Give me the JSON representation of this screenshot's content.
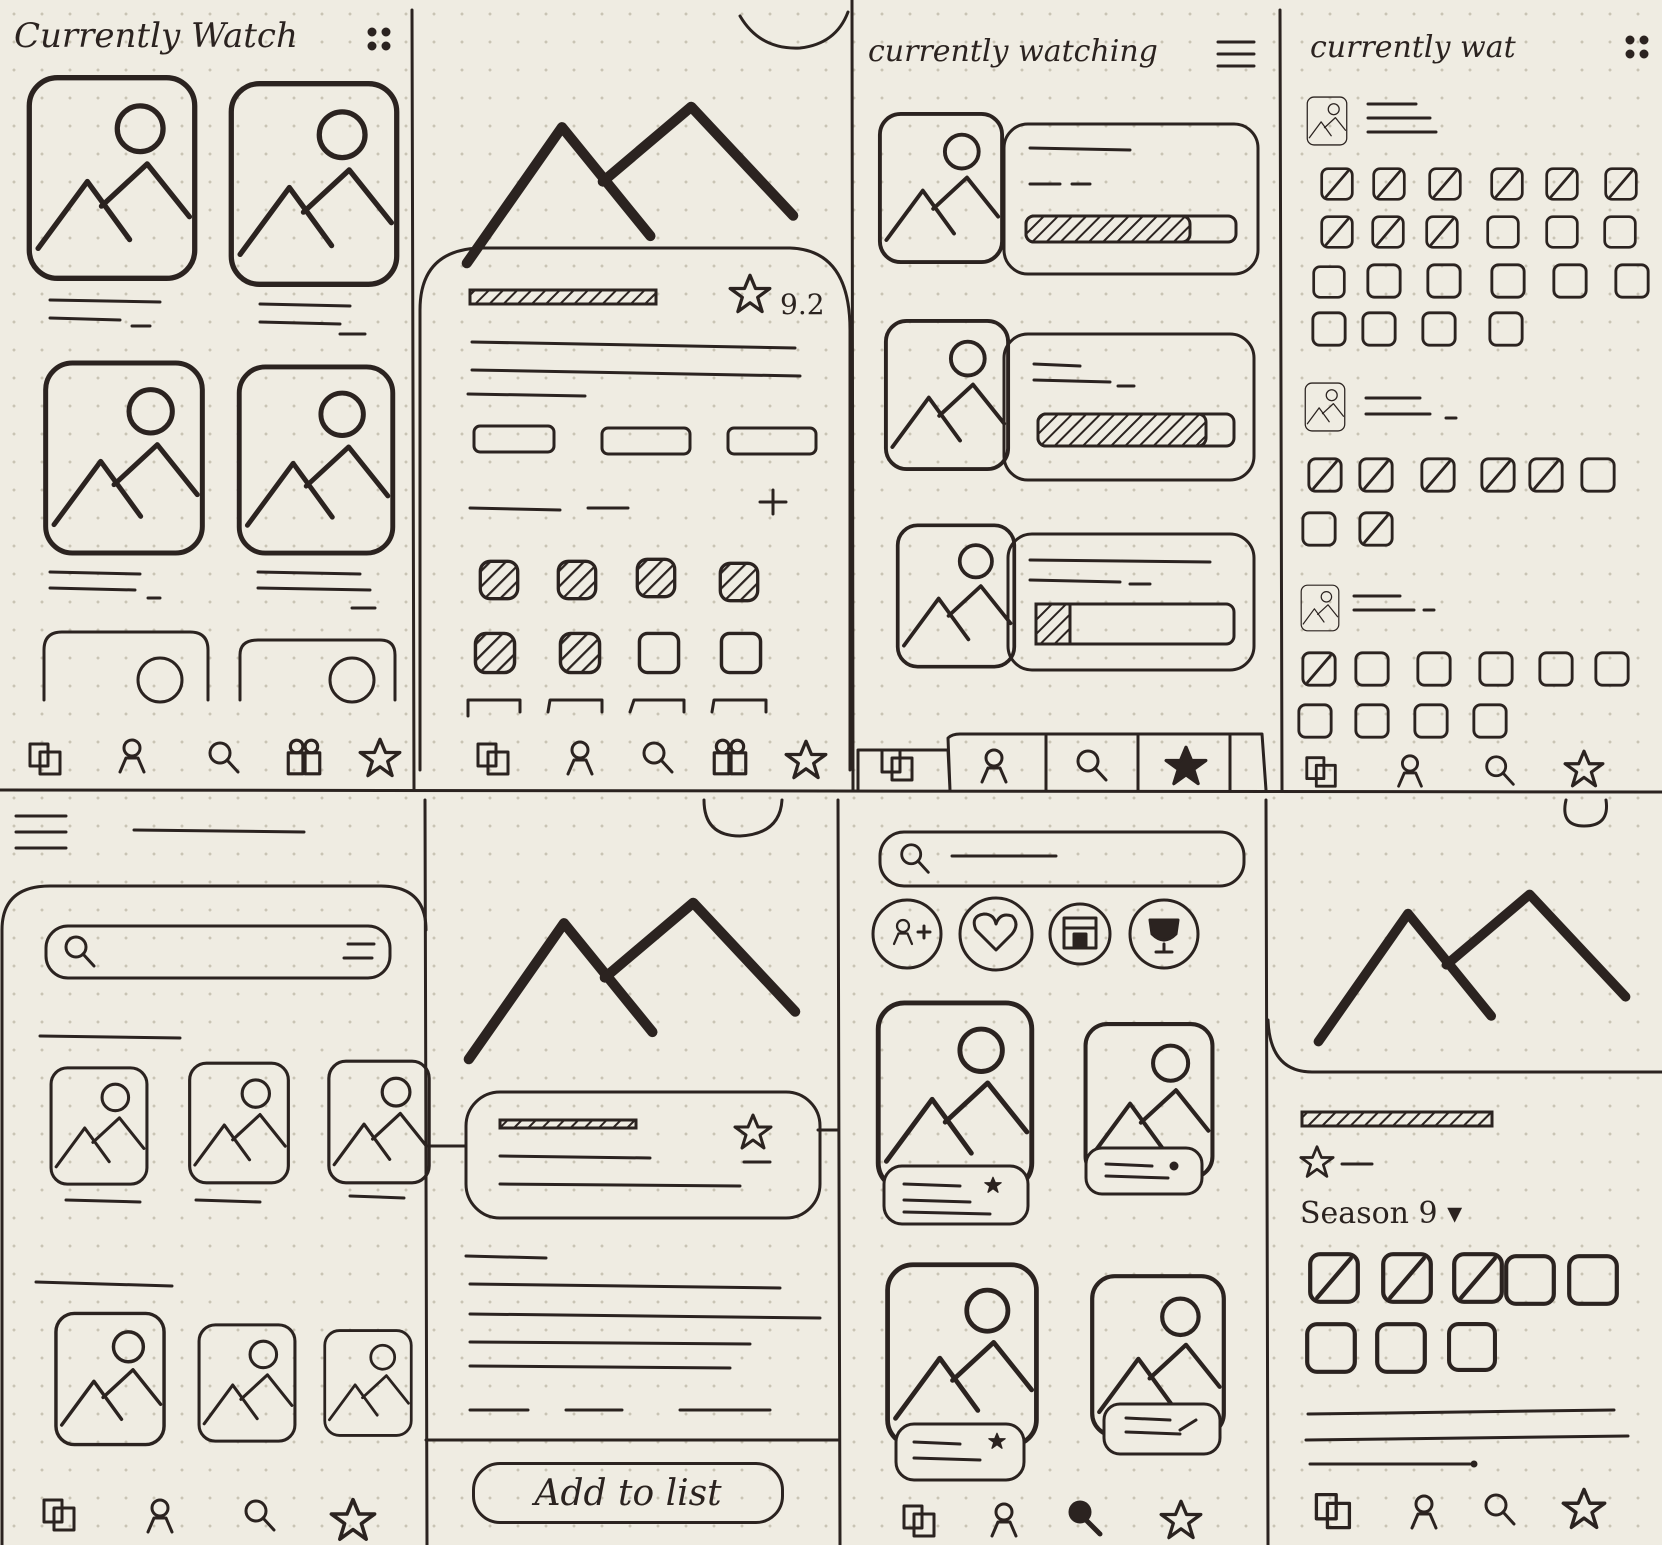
{
  "panels": {
    "p1": {
      "title": "Currently Watch"
    },
    "p2": {
      "rating": "9.2"
    },
    "p3": {
      "title": "currently watching"
    },
    "p4": {
      "title": "currently wat"
    },
    "p6": {
      "button_label": "Add to list"
    },
    "p8": {
      "season_label": "Season 9 ▾"
    }
  },
  "icons": [
    "library-icon",
    "profile-icon",
    "search-icon",
    "awards-icon",
    "star-icon",
    "menu-icon",
    "filter-icon",
    "add-friend-icon",
    "heart-icon",
    "calendar-icon",
    "trophy-icon",
    "plus-icon"
  ],
  "colors": {
    "ink": "#2b2320",
    "paper": "#efece2"
  }
}
